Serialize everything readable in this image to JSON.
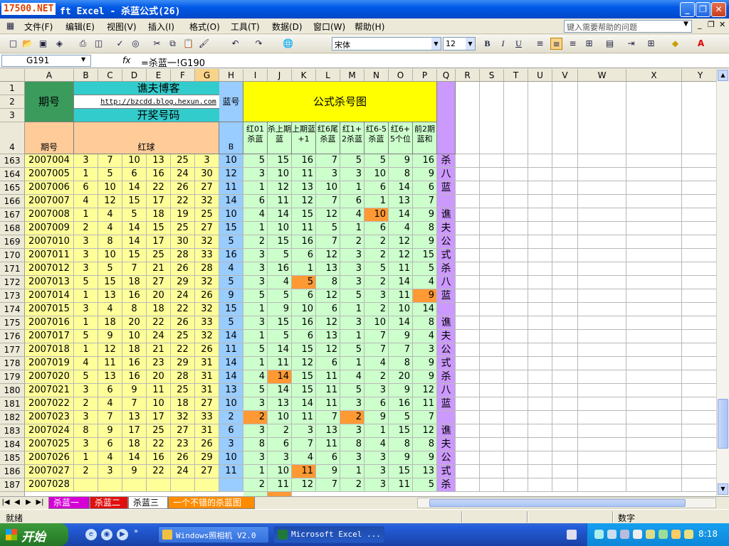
{
  "window": {
    "logo": "17500.NET",
    "title": "ft Excel - 杀蓝公式(26)",
    "min": "_",
    "max": "❐",
    "close": "✕"
  },
  "menu": [
    "文件(F)",
    "编辑(E)",
    "视图(V)",
    "插入(I)",
    "格式(O)",
    "工具(T)",
    "数据(D)",
    "窗口(W)",
    "帮助(H)"
  ],
  "help_placeholder": "键入需要帮助的问题",
  "font_name": "宋体",
  "font_size": "12",
  "namebox": "G191",
  "fx": "fx",
  "formula": "=杀蓝一!G190",
  "columns": [
    "A",
    "B",
    "C",
    "D",
    "E",
    "F",
    "G",
    "H",
    "I",
    "J",
    "K",
    "L",
    "M",
    "N",
    "O",
    "P",
    "Q",
    "R",
    "S",
    "T",
    "U",
    "V",
    "W",
    "X",
    "Y"
  ],
  "selected_column": "G",
  "header_rows": [
    "1",
    "2",
    "3",
    "4"
  ],
  "header": {
    "period": "期号",
    "blog": "谯夫博客",
    "url": "http://bzcdd.blog.hexun.com",
    "draw": "开奖号码",
    "blue_no": "蓝号",
    "formula_map": "公式杀号图",
    "period2": "期号",
    "red": "红球",
    "b": "B",
    "sub": [
      "红01杀蓝",
      "杀上期蓝",
      "上期蓝+1",
      "红6尾杀蓝",
      "红1+2杀蓝",
      "红6-5杀蓝",
      "红6+5个位",
      "前2期蓝和"
    ]
  },
  "side_text": [
    "杀",
    "八",
    "蓝",
    "",
    "谯",
    "夫",
    "公",
    "式",
    "杀",
    "八",
    "蓝",
    "",
    "谯",
    "夫",
    "公",
    "式",
    "杀",
    "八",
    "蓝",
    "",
    "谯",
    "夫",
    "公",
    "式",
    "杀"
  ],
  "rows": [
    {
      "r": "163",
      "p": "2007004",
      "red": [
        "3",
        "7",
        "10",
        "13",
        "25",
        "3"
      ],
      "b": "10",
      "k": [
        "5",
        "15",
        "16",
        "7",
        "5",
        "5",
        "9",
        "16"
      ],
      "o": []
    },
    {
      "r": "164",
      "p": "2007005",
      "red": [
        "1",
        "5",
        "6",
        "16",
        "24",
        "30"
      ],
      "b": "12",
      "k": [
        "3",
        "10",
        "11",
        "3",
        "3",
        "10",
        "8",
        "9"
      ],
      "o": []
    },
    {
      "r": "165",
      "p": "2007006",
      "red": [
        "6",
        "10",
        "14",
        "22",
        "26",
        "27"
      ],
      "b": "11",
      "k": [
        "1",
        "12",
        "13",
        "10",
        "1",
        "6",
        "14",
        "6"
      ],
      "o": []
    },
    {
      "r": "166",
      "p": "2007007",
      "red": [
        "4",
        "12",
        "15",
        "17",
        "22",
        "32"
      ],
      "b": "14",
      "k": [
        "6",
        "11",
        "12",
        "7",
        "6",
        "1",
        "13",
        "7"
      ],
      "o": []
    },
    {
      "r": "167",
      "p": "2007008",
      "red": [
        "1",
        "4",
        "5",
        "18",
        "19",
        "25"
      ],
      "b": "10",
      "k": [
        "4",
        "14",
        "15",
        "12",
        "4",
        "10",
        "14",
        "9"
      ],
      "o": [
        5
      ]
    },
    {
      "r": "168",
      "p": "2007009",
      "red": [
        "2",
        "4",
        "14",
        "15",
        "25",
        "27"
      ],
      "b": "15",
      "k": [
        "1",
        "10",
        "11",
        "5",
        "1",
        "6",
        "4",
        "8"
      ],
      "o": []
    },
    {
      "r": "169",
      "p": "2007010",
      "red": [
        "3",
        "8",
        "14",
        "17",
        "30",
        "32"
      ],
      "b": "5",
      "k": [
        "2",
        "15",
        "16",
        "7",
        "2",
        "2",
        "12",
        "9"
      ],
      "o": []
    },
    {
      "r": "170",
      "p": "2007011",
      "red": [
        "3",
        "10",
        "15",
        "25",
        "28",
        "33"
      ],
      "b": "16",
      "k": [
        "3",
        "5",
        "6",
        "12",
        "3",
        "2",
        "12",
        "15"
      ],
      "o": []
    },
    {
      "r": "171",
      "p": "2007012",
      "red": [
        "3",
        "5",
        "7",
        "21",
        "26",
        "28"
      ],
      "b": "4",
      "k": [
        "3",
        "16",
        "1",
        "13",
        "3",
        "5",
        "11",
        "5"
      ],
      "o": []
    },
    {
      "r": "172",
      "p": "2007013",
      "red": [
        "5",
        "15",
        "18",
        "27",
        "29",
        "32"
      ],
      "b": "5",
      "k": [
        "3",
        "4",
        "5",
        "8",
        "3",
        "2",
        "14",
        "4"
      ],
      "o": [
        2
      ]
    },
    {
      "r": "173",
      "p": "2007014",
      "red": [
        "1",
        "13",
        "16",
        "20",
        "24",
        "26"
      ],
      "b": "9",
      "k": [
        "5",
        "5",
        "6",
        "12",
        "5",
        "3",
        "11",
        "9"
      ],
      "o": [
        7
      ]
    },
    {
      "r": "174",
      "p": "2007015",
      "red": [
        "3",
        "4",
        "8",
        "18",
        "22",
        "32"
      ],
      "b": "15",
      "k": [
        "1",
        "9",
        "10",
        "6",
        "1",
        "2",
        "10",
        "14"
      ],
      "o": []
    },
    {
      "r": "175",
      "p": "2007016",
      "red": [
        "1",
        "18",
        "20",
        "22",
        "26",
        "33"
      ],
      "b": "5",
      "k": [
        "3",
        "15",
        "16",
        "12",
        "3",
        "10",
        "14",
        "8"
      ],
      "o": []
    },
    {
      "r": "176",
      "p": "2007017",
      "red": [
        "5",
        "9",
        "10",
        "24",
        "25",
        "32"
      ],
      "b": "14",
      "k": [
        "1",
        "5",
        "6",
        "13",
        "1",
        "7",
        "9",
        "4"
      ],
      "o": []
    },
    {
      "r": "177",
      "p": "2007018",
      "red": [
        "1",
        "12",
        "18",
        "21",
        "22",
        "26"
      ],
      "b": "11",
      "k": [
        "5",
        "14",
        "15",
        "12",
        "5",
        "7",
        "7",
        "3"
      ],
      "o": []
    },
    {
      "r": "178",
      "p": "2007019",
      "red": [
        "4",
        "11",
        "16",
        "23",
        "29",
        "31"
      ],
      "b": "14",
      "k": [
        "1",
        "11",
        "12",
        "6",
        "1",
        "4",
        "8",
        "9"
      ],
      "o": []
    },
    {
      "r": "179",
      "p": "2007020",
      "red": [
        "5",
        "13",
        "16",
        "20",
        "28",
        "31"
      ],
      "b": "14",
      "k": [
        "4",
        "14",
        "15",
        "11",
        "4",
        "2",
        "20",
        "9"
      ],
      "o": [
        1
      ]
    },
    {
      "r": "180",
      "p": "2007021",
      "red": [
        "3",
        "6",
        "9",
        "11",
        "25",
        "31"
      ],
      "b": "13",
      "k": [
        "5",
        "14",
        "15",
        "11",
        "5",
        "3",
        "9",
        "12"
      ],
      "o": []
    },
    {
      "r": "181",
      "p": "2007022",
      "red": [
        "2",
        "4",
        "7",
        "10",
        "18",
        "27"
      ],
      "b": "10",
      "k": [
        "3",
        "13",
        "14",
        "11",
        "3",
        "6",
        "16",
        "11"
      ],
      "o": []
    },
    {
      "r": "182",
      "p": "2007023",
      "red": [
        "3",
        "7",
        "13",
        "17",
        "32",
        "33"
      ],
      "b": "2",
      "k": [
        "2",
        "10",
        "11",
        "7",
        "2",
        "9",
        "5",
        "7"
      ],
      "o": [
        0,
        4
      ]
    },
    {
      "r": "183",
      "p": "2007024",
      "red": [
        "8",
        "9",
        "17",
        "25",
        "27",
        "31"
      ],
      "b": "6",
      "k": [
        "3",
        "2",
        "3",
        "13",
        "3",
        "1",
        "15",
        "12"
      ],
      "o": []
    },
    {
      "r": "184",
      "p": "2007025",
      "red": [
        "3",
        "6",
        "18",
        "22",
        "23",
        "26"
      ],
      "b": "3",
      "k": [
        "8",
        "6",
        "7",
        "11",
        "8",
        "4",
        "8",
        "8"
      ],
      "o": []
    },
    {
      "r": "185",
      "p": "2007026",
      "red": [
        "1",
        "4",
        "14",
        "16",
        "26",
        "29"
      ],
      "b": "10",
      "k": [
        "3",
        "3",
        "4",
        "6",
        "3",
        "3",
        "9",
        "9"
      ],
      "o": []
    },
    {
      "r": "186",
      "p": "2007027",
      "red": [
        "2",
        "3",
        "9",
        "22",
        "24",
        "27"
      ],
      "b": "11",
      "k": [
        "1",
        "10",
        "11",
        "9",
        "1",
        "3",
        "15",
        "13"
      ],
      "o": [
        2
      ]
    },
    {
      "r": "187",
      "p": "2007028",
      "red": [
        "",
        "",
        "",
        "",
        "",
        ""
      ],
      "b": "",
      "k": [
        "2",
        "11",
        "12",
        "7",
        "2",
        "3",
        "11",
        "5"
      ],
      "o": []
    }
  ],
  "sheets": [
    {
      "label": "杀蓝一",
      "bg": "#d400d4",
      "color": "#ffffff"
    },
    {
      "label": "杀蓝二",
      "bg": "#e01010",
      "color": "#ffffff"
    },
    {
      "label": "杀蓝三",
      "bg": "#ffffff",
      "color": "#000000"
    },
    {
      "label": "一个不错的杀蓝图",
      "bg": "#ff8c00",
      "color": "#ffffff"
    }
  ],
  "status": {
    "left": "就绪",
    "num": "数字"
  },
  "taskbar": {
    "start": "开始",
    "tasks": [
      "Windows照相机 V2.0",
      "Microsoft Excel ..."
    ],
    "clock": "8:18"
  },
  "colors": {
    "period": "#3a9b5c",
    "header_cyan": "#33cccc",
    "yellow": "#ffff00",
    "pink": "#ffcc99",
    "blue": "#99ccff",
    "green": "#ccffcc",
    "purple": "#cc99ff",
    "orange": "#ff9933",
    "light_yellow": "#ffff99"
  }
}
